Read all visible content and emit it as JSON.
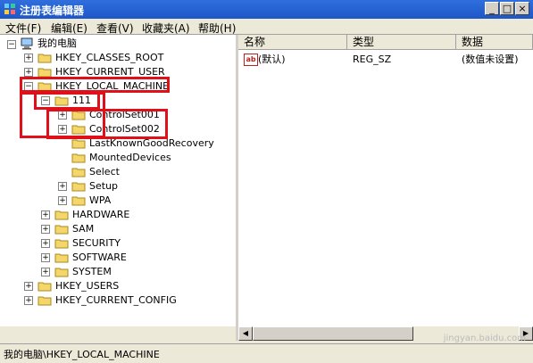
{
  "window": {
    "title": "注册表编辑器"
  },
  "controls": {
    "minimize": "_",
    "maximize": "□",
    "close": "×"
  },
  "menu": [
    "文件(F)",
    "编辑(E)",
    "查看(V)",
    "收藏夹(A)",
    "帮助(H)"
  ],
  "tree": {
    "root": "我的电脑",
    "items": [
      {
        "label": "HKEY_CLASSES_ROOT",
        "level": 1,
        "exp": "+"
      },
      {
        "label": "HKEY_CURRENT_USER",
        "level": 1,
        "exp": "+"
      },
      {
        "label": "HKEY_LOCAL_MACHINE",
        "level": 1,
        "exp": "-"
      },
      {
        "label": "111",
        "level": 2,
        "exp": "-"
      },
      {
        "label": "ControlSet001",
        "level": 3,
        "exp": "+"
      },
      {
        "label": "ControlSet002",
        "level": 3,
        "exp": "+"
      },
      {
        "label": "LastKnownGoodRecovery",
        "level": 3,
        "exp": ""
      },
      {
        "label": "MountedDevices",
        "level": 3,
        "exp": ""
      },
      {
        "label": "Select",
        "level": 3,
        "exp": ""
      },
      {
        "label": "Setup",
        "level": 3,
        "exp": "+"
      },
      {
        "label": "WPA",
        "level": 3,
        "exp": "+"
      },
      {
        "label": "HARDWARE",
        "level": 2,
        "exp": "+"
      },
      {
        "label": "SAM",
        "level": 2,
        "exp": "+"
      },
      {
        "label": "SECURITY",
        "level": 2,
        "exp": "+"
      },
      {
        "label": "SOFTWARE",
        "level": 2,
        "exp": "+"
      },
      {
        "label": "SYSTEM",
        "level": 2,
        "exp": "+"
      },
      {
        "label": "HKEY_USERS",
        "level": 1,
        "exp": "+"
      },
      {
        "label": "HKEY_CURRENT_CONFIG",
        "level": 1,
        "exp": "+"
      }
    ]
  },
  "list": {
    "columns": [
      "名称",
      "类型",
      "数据"
    ],
    "rows": [
      {
        "name": "(默认)",
        "type": "REG_SZ",
        "data": "(数值未设置)",
        "icon": "ab"
      }
    ]
  },
  "status": "我的电脑\\HKEY_LOCAL_MACHINE",
  "watermark": "jingyan.baidu.com",
  "colors": {
    "highlight": "#e0101a",
    "folder": "#f5d66b",
    "titlebar": "#1e56c8"
  }
}
